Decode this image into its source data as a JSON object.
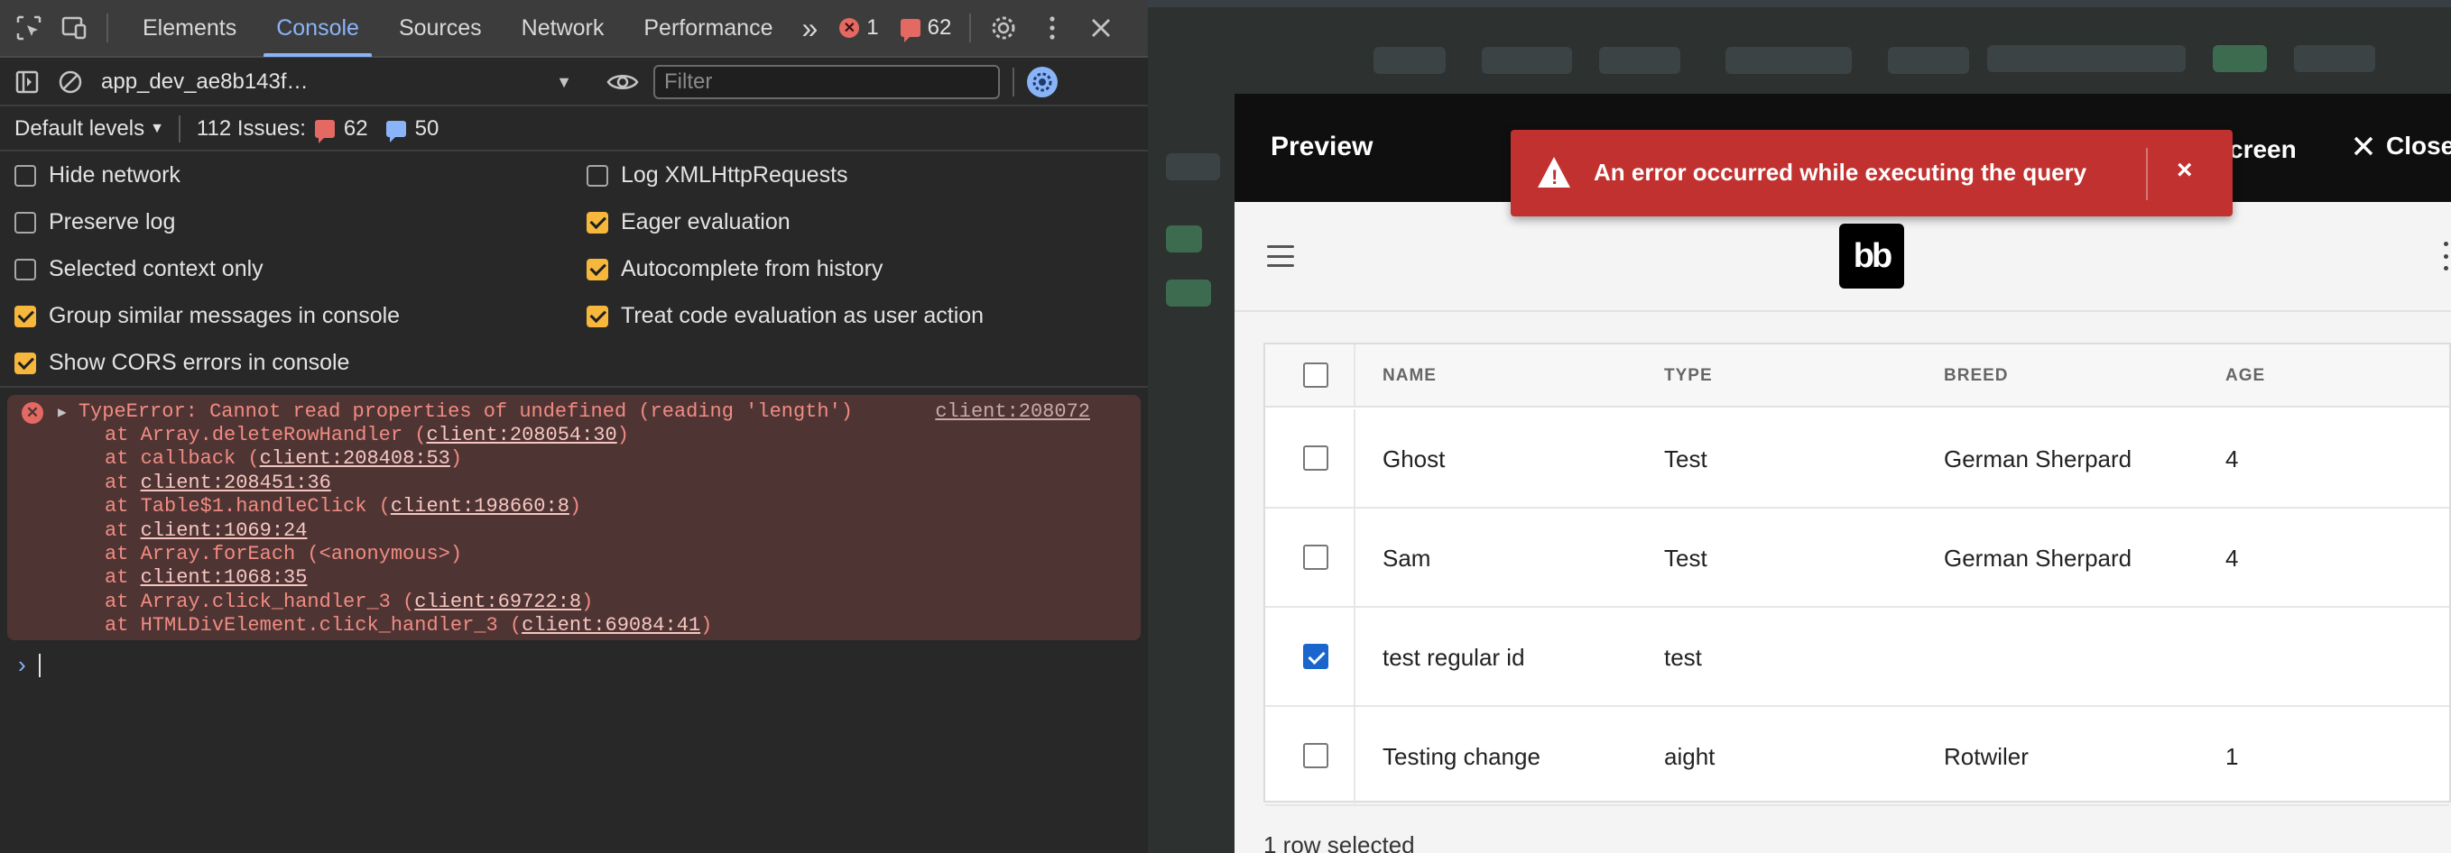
{
  "devtools": {
    "tabs": [
      {
        "label": "Elements"
      },
      {
        "label": "Console"
      },
      {
        "label": "Sources"
      },
      {
        "label": "Network"
      },
      {
        "label": "Performance"
      }
    ],
    "more_tabs": "»",
    "error_count": "1",
    "issue_count": "62",
    "context": "app_dev_ae8b143f…",
    "filter_placeholder": "Filter",
    "levels_label": "Default levels",
    "issues_label": "112 Issues:",
    "issues_errors": "62",
    "issues_info": "50",
    "settings": {
      "hide_network": {
        "label": "Hide network",
        "checked": false
      },
      "preserve_log": {
        "label": "Preserve log",
        "checked": false
      },
      "selected_context": {
        "label": "Selected context only",
        "checked": false
      },
      "group_similar": {
        "label": "Group similar messages in console",
        "checked": true
      },
      "show_cors": {
        "label": "Show CORS errors in console",
        "checked": true
      },
      "log_xhr": {
        "label": "Log XMLHttpRequests",
        "checked": false
      },
      "eager_eval": {
        "label": "Eager evaluation",
        "checked": true
      },
      "autocomplete": {
        "label": "Autocomplete from history",
        "checked": true
      },
      "treat_code": {
        "label": "Treat code evaluation as user action",
        "checked": true
      }
    },
    "error": {
      "message": "TypeError: Cannot read properties of undefined (reading 'length')",
      "source": "client:208072",
      "stack": [
        {
          "pre": "at Array.deleteRowHandler (",
          "link": "client:208054:30",
          "post": ")"
        },
        {
          "pre": "at callback (",
          "link": "client:208408:53",
          "post": ")"
        },
        {
          "pre": "at ",
          "link": "client:208451:36",
          "post": ""
        },
        {
          "pre": "at Table$1.handleClick (",
          "link": "client:198660:8",
          "post": ")"
        },
        {
          "pre": "at ",
          "link": "client:1069:24",
          "post": ""
        },
        {
          "pre": "at Array.forEach (<anonymous>)",
          "link": "",
          "post": ""
        },
        {
          "pre": "at ",
          "link": "client:1068:35",
          "post": ""
        },
        {
          "pre": "at Array.click_handler_3 (",
          "link": "client:69722:8",
          "post": ")"
        },
        {
          "pre": "at HTMLDivElement.click_handler_3 (",
          "link": "client:69084:41",
          "post": ")"
        }
      ]
    },
    "prompt_symbol": "›"
  },
  "app": {
    "preview_title": "Preview",
    "fullscreen_label": "creen",
    "close_label": "Close",
    "toast_message": "An error occurred while executing the query",
    "logo_text": "bb",
    "table": {
      "headers": [
        "NAME",
        "TYPE",
        "BREED",
        "AGE"
      ],
      "rows": [
        {
          "name": "Ghost",
          "type": "Test",
          "breed": "German Sherpard",
          "age": "4",
          "selected": false
        },
        {
          "name": "Sam",
          "type": "Test",
          "breed": "German Sherpard",
          "age": "4",
          "selected": false
        },
        {
          "name": "test regular id",
          "type": "test",
          "breed": "",
          "age": "",
          "selected": true
        },
        {
          "name": "Testing change",
          "type": "aight",
          "breed": "Rotwiler",
          "age": "1",
          "selected": false
        }
      ]
    },
    "footer_text": "1 row selected"
  },
  "colors": {
    "accent_blue": "#8ab4f8",
    "error_red": "#e46962",
    "toast_red": "#c1312f",
    "checkbox_orange": "#f6b73c",
    "checkbox_blue": "#1a66cc"
  }
}
